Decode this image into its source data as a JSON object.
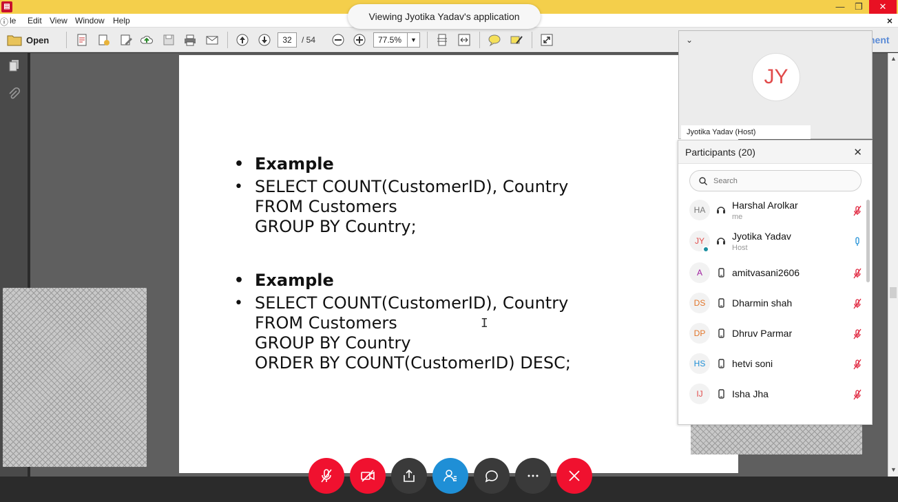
{
  "menu": {
    "items": [
      "le",
      "Edit",
      "View",
      "Window",
      "Help"
    ]
  },
  "share_banner": "Viewing Jyotika Yadav's application",
  "toolbar": {
    "open_label": "Open",
    "page_current": "32",
    "page_total": "/ 54",
    "zoom": "77.5%",
    "comment_fragment": "nent"
  },
  "slide": {
    "block1_heading": "Example",
    "block1_lines": [
      "SELECT COUNT(CustomerID), Country",
      "FROM Customers",
      "GROUP BY Country;"
    ],
    "block2_heading": "Example",
    "block2_lines": [
      "SELECT COUNT(CustomerID), Country",
      "FROM Customers",
      "GROUP BY Country",
      "ORDER BY COUNT(CustomerID) DESC;"
    ]
  },
  "video_tile": {
    "initials": "JY",
    "label": "Jyotika Yadav (Host)"
  },
  "participants": {
    "title": "Participants (20)",
    "search_placeholder": "Search",
    "list": [
      {
        "initials": "HA",
        "name": "Harshal Arolkar",
        "sub": "me",
        "device": "headset",
        "color": "#777777",
        "mic": "muted"
      },
      {
        "initials": "JY",
        "name": "Jyotika Yadav",
        "sub": "Host",
        "device": "headset",
        "color": "#e14b4b",
        "mic": "active"
      },
      {
        "initials": "A",
        "name": "amitvasani2606",
        "sub": "",
        "device": "phone",
        "color": "#a020a0",
        "mic": "muted"
      },
      {
        "initials": "DS",
        "name": "Dharmin shah",
        "sub": "",
        "device": "phone",
        "color": "#e2762a",
        "mic": "muted"
      },
      {
        "initials": "DP",
        "name": "Dhruv Parmar",
        "sub": "",
        "device": "phone",
        "color": "#e2762a",
        "mic": "muted"
      },
      {
        "initials": "HS",
        "name": "hetvi soni",
        "sub": "",
        "device": "phone",
        "color": "#1f8fd6",
        "mic": "muted"
      },
      {
        "initials": "IJ",
        "name": "Isha Jha",
        "sub": "",
        "device": "phone",
        "color": "#e14b4b",
        "mic": "muted"
      }
    ]
  },
  "colors": {
    "call_red": "#f0112f",
    "call_blue": "#1f8fd6",
    "title_bar": "#f4cf4b"
  }
}
